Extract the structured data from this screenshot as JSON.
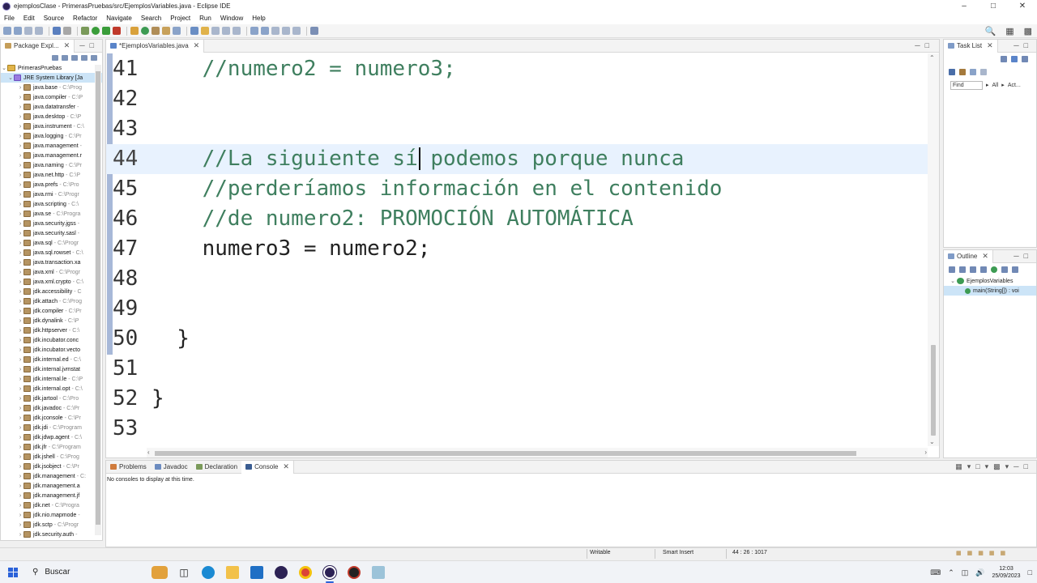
{
  "window": {
    "title": "ejemplosClase - PrimerasPruebas/src/EjemplosVariables.java - Eclipse IDE"
  },
  "menu": [
    "File",
    "Edit",
    "Source",
    "Refactor",
    "Navigate",
    "Search",
    "Project",
    "Run",
    "Window",
    "Help"
  ],
  "package_explorer": {
    "tab_label": "Package Expl...",
    "project": "PrimerasPruebas",
    "library": "JRE System Library [Ja",
    "items": [
      {
        "name": "java.base",
        "path": "- C:\\Prog"
      },
      {
        "name": "java.compiler",
        "path": "- C:\\P"
      },
      {
        "name": "java.datatransfer",
        "path": "- "
      },
      {
        "name": "java.desktop",
        "path": "- C:\\P"
      },
      {
        "name": "java.instrument",
        "path": "- C:\\"
      },
      {
        "name": "java.logging",
        "path": "- C:\\Pr"
      },
      {
        "name": "java.management",
        "path": "- "
      },
      {
        "name": "java.management.r",
        "path": ""
      },
      {
        "name": "java.naming",
        "path": "- C:\\Pr"
      },
      {
        "name": "java.net.http",
        "path": "- C:\\P"
      },
      {
        "name": "java.prefs",
        "path": "- C:\\Pro"
      },
      {
        "name": "java.rmi",
        "path": "- C:\\Progr"
      },
      {
        "name": "java.scripting",
        "path": "- C:\\"
      },
      {
        "name": "java.se",
        "path": "- C:\\Progra"
      },
      {
        "name": "java.security.jgss",
        "path": "- "
      },
      {
        "name": "java.security.sasl",
        "path": "- "
      },
      {
        "name": "java.sql",
        "path": "- C:\\Progr"
      },
      {
        "name": "java.sql.rowset",
        "path": "- C:\\"
      },
      {
        "name": "java.transaction.xa",
        "path": ""
      },
      {
        "name": "java.xml",
        "path": "- C:\\Progr"
      },
      {
        "name": "java.xml.crypto",
        "path": "- C:\\"
      },
      {
        "name": "jdk.accessibility",
        "path": "- C"
      },
      {
        "name": "jdk.attach",
        "path": "- C:\\Prog"
      },
      {
        "name": "jdk.compiler",
        "path": "- C:\\Pr"
      },
      {
        "name": "jdk.dynalink",
        "path": "- C:\\P"
      },
      {
        "name": "jdk.httpserver",
        "path": "- C:\\"
      },
      {
        "name": "jdk.incubator.conc",
        "path": ""
      },
      {
        "name": "jdk.incubator.vecto",
        "path": ""
      },
      {
        "name": "jdk.internal.ed",
        "path": "- C:\\"
      },
      {
        "name": "jdk.internal.jvmstat",
        "path": ""
      },
      {
        "name": "jdk.internal.le",
        "path": "- C:\\P"
      },
      {
        "name": "jdk.internal.opt",
        "path": "- C:\\"
      },
      {
        "name": "jdk.jartool",
        "path": "- C:\\Pro"
      },
      {
        "name": "jdk.javadoc",
        "path": "- C:\\Pr"
      },
      {
        "name": "jdk.jconsole",
        "path": "- C:\\Pr"
      },
      {
        "name": "jdk.jdi",
        "path": "- C:\\Program"
      },
      {
        "name": "jdk.jdwp.agent",
        "path": "- C:\\"
      },
      {
        "name": "jdk.jfr",
        "path": "- C:\\Program"
      },
      {
        "name": "jdk.jshell",
        "path": "- C:\\Prog"
      },
      {
        "name": "jdk.jsobject",
        "path": "- C:\\Pr"
      },
      {
        "name": "jdk.management",
        "path": "- C:"
      },
      {
        "name": "jdk.management.a",
        "path": ""
      },
      {
        "name": "jdk.management.jf",
        "path": ""
      },
      {
        "name": "jdk.net",
        "path": "- C:\\Progra"
      },
      {
        "name": "jdk.nio.mapmode",
        "path": "- "
      },
      {
        "name": "jdk.sctp",
        "path": "- C:\\Progr"
      },
      {
        "name": "jdk.security.auth",
        "path": "- "
      }
    ]
  },
  "editor": {
    "tab_label": "*EjemplosVariables.java",
    "lines": [
      {
        "num": "41",
        "text": "    //numero2 = numero3;",
        "kind": "comment"
      },
      {
        "num": "42",
        "text": "",
        "kind": "plain"
      },
      {
        "num": "43",
        "text": "",
        "kind": "plain"
      },
      {
        "num": "44",
        "text": "    //La siguiente sí podemos porque nunca",
        "kind": "comment"
      },
      {
        "num": "45",
        "text": "    //perderíamos información en el contenido",
        "kind": "comment"
      },
      {
        "num": "46",
        "text": "    //de numero2: PROMOCIÓN AUTOMÁTICA",
        "kind": "comment"
      },
      {
        "num": "47",
        "text": "    numero3 = numero2;",
        "kind": "plain"
      },
      {
        "num": "48",
        "text": "",
        "kind": "plain"
      },
      {
        "num": "49",
        "text": "",
        "kind": "plain"
      },
      {
        "num": "50",
        "text": "  }",
        "kind": "plain"
      },
      {
        "num": "51",
        "text": "",
        "kind": "plain"
      },
      {
        "num": "52",
        "text": "}",
        "kind": "plain"
      },
      {
        "num": "53",
        "text": "",
        "kind": "plain"
      }
    ],
    "current_line": "44"
  },
  "task_list": {
    "tab_label": "Task List",
    "find_placeholder": "Find",
    "all_label": "All",
    "activate_label": "Act..."
  },
  "outline": {
    "tab_label": "Outline",
    "class_name": "EjemplosVariables",
    "method_name": "main(String[]) : voi"
  },
  "console": {
    "tabs": [
      "Problems",
      "Javadoc",
      "Declaration",
      "Console"
    ],
    "message": "No consoles to display at this time."
  },
  "status": {
    "writable": "Writable",
    "insert_mode": "Smart Insert",
    "position": "44 : 26 : 1017"
  },
  "taskbar": {
    "search_label": "Buscar",
    "time": "12:03",
    "date": "25/09/2023"
  },
  "colors": {
    "comment": "#3f7f5f",
    "current_line": "#e8f2fe",
    "selection": "#cce4f7"
  }
}
